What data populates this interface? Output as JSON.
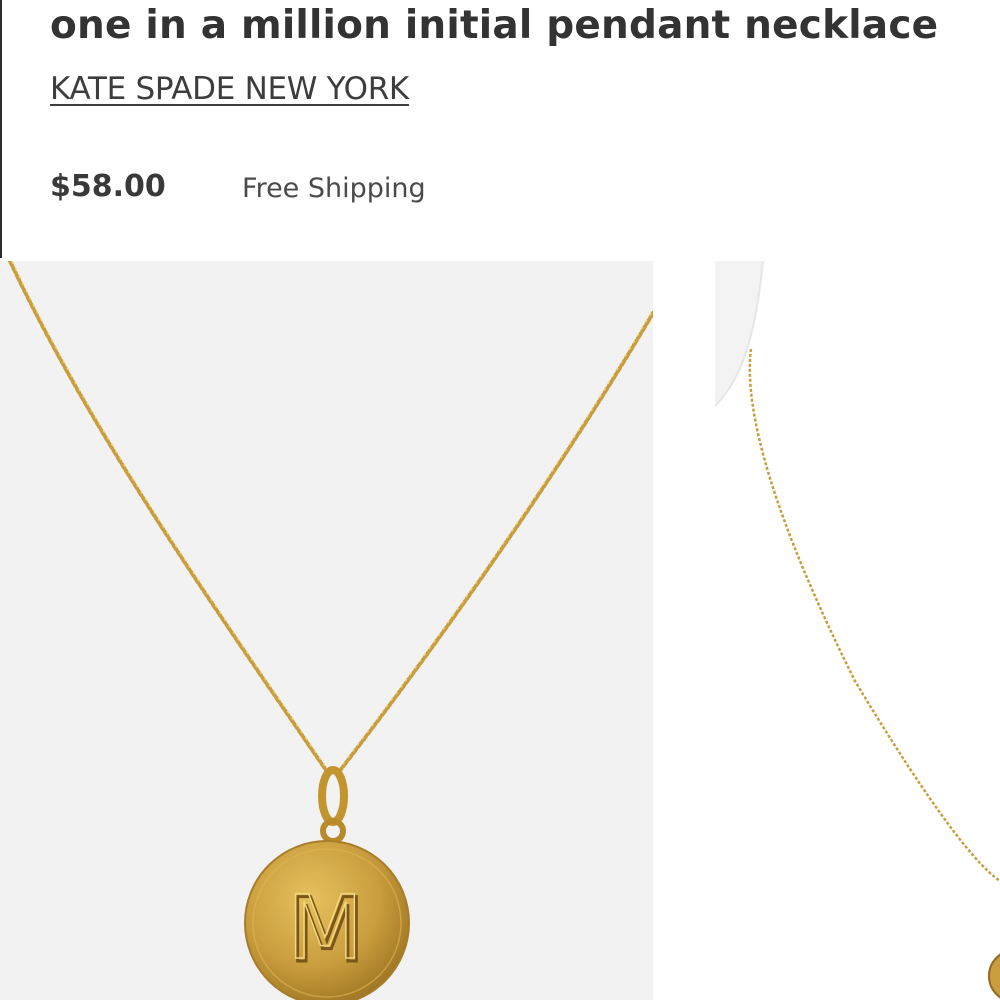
{
  "product": {
    "title": "one in a million initial pendant necklace",
    "brand": "KATE SPADE NEW YORK",
    "price": "$58.00",
    "shipping": "Free Shipping"
  },
  "gallery": {
    "images": [
      {
        "description": "gold chain necklace with round pendant engraved with the letter M",
        "pendant_letter": "M"
      },
      {
        "description": "necklace shown on white display bust"
      }
    ]
  },
  "colors": {
    "gold": "#c79a3a",
    "gold_light": "#e2bf63",
    "background": "#f2f2f2",
    "text": "#393939"
  }
}
